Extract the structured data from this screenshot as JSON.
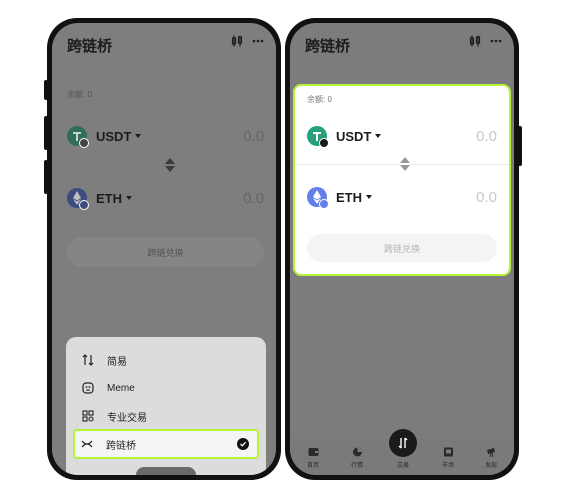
{
  "left_screen": {
    "title": "跨链桥",
    "balance_label": "余额: 0",
    "from_token": {
      "symbol": "USDT",
      "amount": "0.0"
    },
    "to_token": {
      "symbol": "ETH",
      "amount": "0.0"
    },
    "swap_button": "跨链兑换",
    "menu": {
      "items": [
        {
          "label": "简易",
          "icon": "arrows-updown-icon"
        },
        {
          "label": "Meme",
          "icon": "meme-icon"
        },
        {
          "label": "专业交易",
          "icon": "grid-icon"
        },
        {
          "label": "跨链桥",
          "icon": "bridge-icon",
          "selected": true
        }
      ]
    }
  },
  "right_screen": {
    "title": "跨链桥",
    "balance_label": "余额: 0",
    "from_token": {
      "symbol": "USDT",
      "amount": "0.0"
    },
    "to_token": {
      "symbol": "ETH",
      "amount": "0.0"
    },
    "swap_button": "跨链兑换",
    "tabs": [
      {
        "label": "首页",
        "icon": "wallet-icon"
      },
      {
        "label": "行情",
        "icon": "chart-icon"
      },
      {
        "label": "交易",
        "icon": "trade-icon"
      },
      {
        "label": "市场",
        "icon": "market-icon"
      },
      {
        "label": "发现",
        "icon": "discover-icon"
      }
    ]
  },
  "colors": {
    "highlight": "#b6f236",
    "usdt": "#26a17b",
    "eth": "#627eea",
    "dark_overlay": "#7e7e7e"
  }
}
